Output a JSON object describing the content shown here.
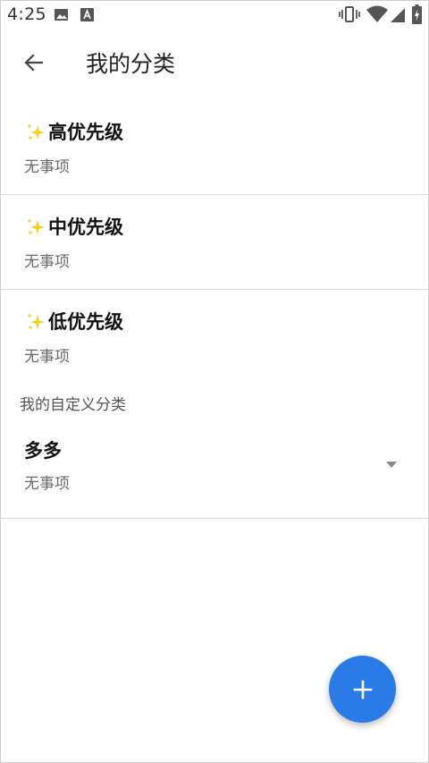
{
  "status_bar": {
    "time": "4:25",
    "left_icons": [
      "image-icon",
      "a-text-icon"
    ],
    "right_icons": [
      "vibrate-icon",
      "wifi-icon",
      "signal-icon",
      "battery-charging-icon"
    ]
  },
  "header": {
    "title": "我的分类",
    "back_icon": "arrow-back-icon"
  },
  "categories": [
    {
      "name": "高优先级",
      "count_text": "无事项",
      "icon": "sparkle-icon"
    },
    {
      "name": "中优先级",
      "count_text": "无事项",
      "icon": "sparkle-icon"
    },
    {
      "name": "低优先级",
      "count_text": "无事项",
      "icon": "sparkle-icon"
    }
  ],
  "custom_section": {
    "header": "我的自定义分类",
    "items": [
      {
        "name": "多多",
        "count_text": "无事项",
        "icon": "dropdown-arrow-icon"
      }
    ]
  },
  "fab": {
    "icon": "plus-icon"
  },
  "colors": {
    "accent": "#2a7ae8",
    "sparkle": "#f2d21a",
    "secondary_text": "#6a6a6a",
    "divider": "#dcdcdc"
  }
}
